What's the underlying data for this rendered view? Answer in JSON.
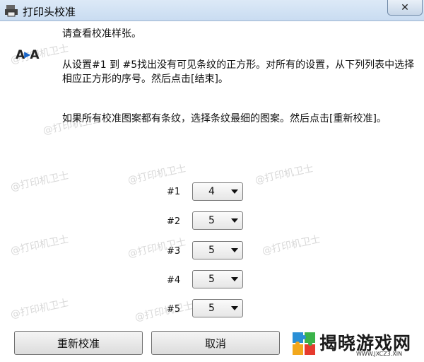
{
  "window": {
    "title": "打印头校准",
    "close_label": "✕"
  },
  "instructions": {
    "line1": "请查看校准样张。",
    "line2": "从设置#1 到 #5找出没有可见条纹的正方形。对所有的设置，从下列列表中选择相应正方形的序号。然后点击[结束]。",
    "line3": "如果所有校准图案都有条纹，选择条纹最细的图案。然后点击[重新校准]。"
  },
  "icon_text": {
    "left": "A",
    "right": "A"
  },
  "settings": [
    {
      "label": "#1",
      "value": "4"
    },
    {
      "label": "#2",
      "value": "5"
    },
    {
      "label": "#3",
      "value": "5"
    },
    {
      "label": "#4",
      "value": "5"
    },
    {
      "label": "#5",
      "value": "5"
    }
  ],
  "buttons": {
    "recalibrate": "重新校准",
    "cancel": "取消"
  },
  "watermark": "@打印机卫士",
  "brand": {
    "name": "揭晓游戏网",
    "url": "WWW.JXCZ3.XIN"
  },
  "colors": {
    "titlebar": "#c9dcf1",
    "accent": "#1a66c9"
  }
}
